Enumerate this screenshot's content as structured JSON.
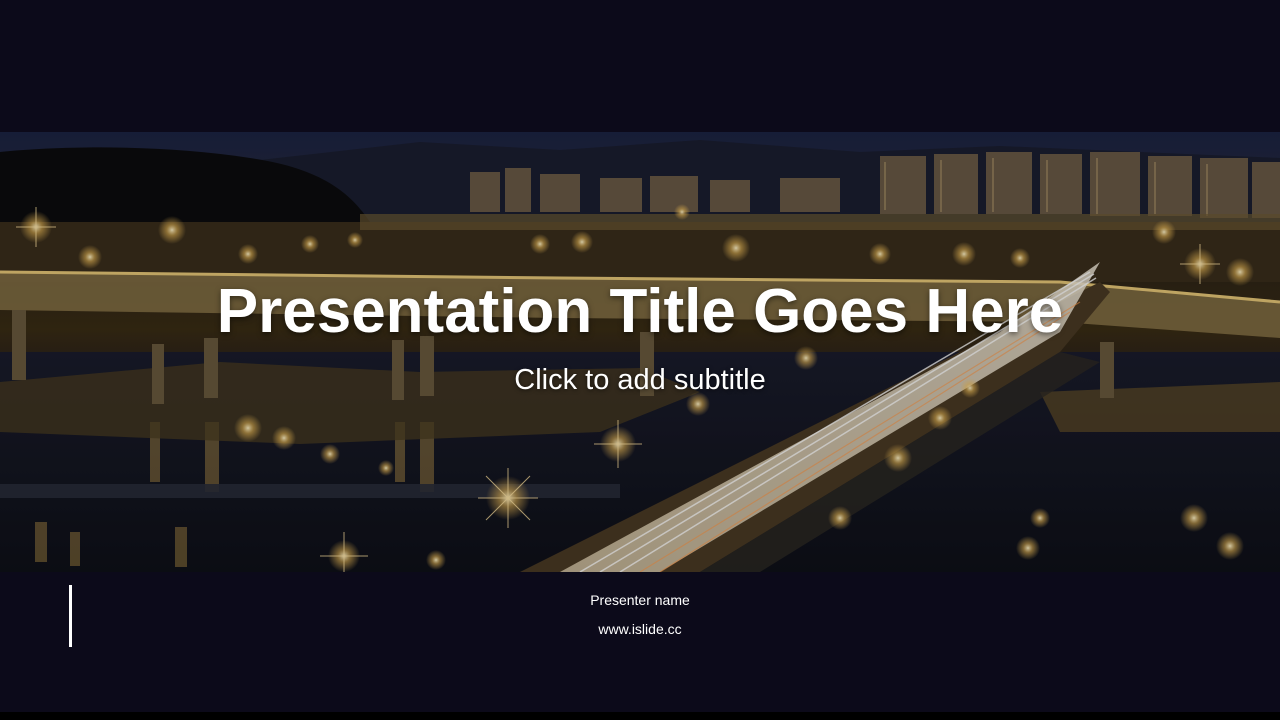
{
  "slide": {
    "title": "Presentation Title Goes Here",
    "subtitle": "Click to add subtitle",
    "presenter": "Presenter name",
    "website": "www.islide.cc"
  },
  "photo": {
    "description_icon": "city-night-bridge-image"
  },
  "colors": {
    "background": "#0c0a1a",
    "text": "#ffffff",
    "light_glow": "#f5c25a"
  }
}
